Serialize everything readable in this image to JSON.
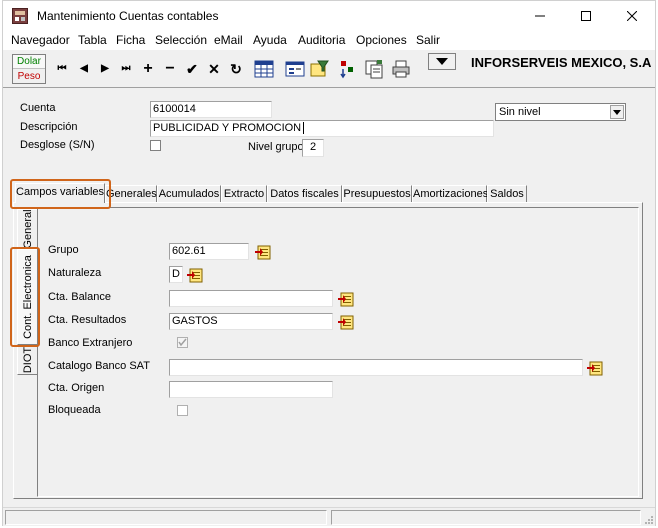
{
  "window": {
    "title": "Mantenimiento Cuentas contables"
  },
  "menu": [
    "Navegador",
    "Tabla",
    "Ficha",
    "Selección",
    "eMail",
    "Ayuda",
    "Auditoria",
    "Opciones",
    "Salir"
  ],
  "toolbar": {
    "currency_dolar": "Dolar",
    "currency_peso": "Peso",
    "company_name": "INFORSERVEIS MEXICO, S.A",
    "nav_buttons": [
      "first-record",
      "prior-record",
      "next-record",
      "last-record",
      "insert-record",
      "delete-record",
      "post-edit",
      "cancel-edit",
      "refresh-data"
    ],
    "nav_glyphs": [
      "⏮",
      "◀",
      "▶",
      "⏭",
      "+",
      "−",
      "✔",
      "✕",
      "↻"
    ]
  },
  "header": {
    "cuenta_label": "Cuenta",
    "cuenta_value": "6100014",
    "descripcion_label": "Descripción",
    "descripcion_value": "PUBLICIDAD Y PROMOCION",
    "desglose_label": "Desglose (S/N)",
    "desglose_checked": false,
    "nivel_label": "Nivel grupo",
    "nivel_value": "2",
    "nivel_select_value": "Sin nivel"
  },
  "tabs": [
    "Campos variables",
    "Generales",
    "Acumulados",
    "Extracto",
    "Datos fiscales",
    "Presupuestos",
    "Amortizaciones",
    "Saldos"
  ],
  "active_tab": "Campos variables",
  "side_tabs": [
    "General",
    "Cont. Electronica",
    "DIOT"
  ],
  "active_side_tab": "Cont. Electronica",
  "form": {
    "grupo_label": "Grupo",
    "grupo_value": "602.61",
    "naturaleza_label": "Naturaleza",
    "naturaleza_value": "D",
    "cta_balance_label": "Cta. Balance",
    "cta_balance_value": "",
    "cta_resultados_label": "Cta. Resultados",
    "cta_resultados_value": "GASTOS",
    "banco_extranjero_label": "Banco Extranjero",
    "banco_extranjero_checked": true,
    "catalogo_label": "Catalogo Banco SAT",
    "catalogo_value": "",
    "cta_origen_label": "Cta. Origen",
    "cta_origen_value": "",
    "bloqueada_label": "Bloqueada",
    "bloqueada_checked": false
  },
  "colors": {
    "highlight": "#d0651a",
    "dolar": "#008000",
    "peso": "#c00000"
  }
}
